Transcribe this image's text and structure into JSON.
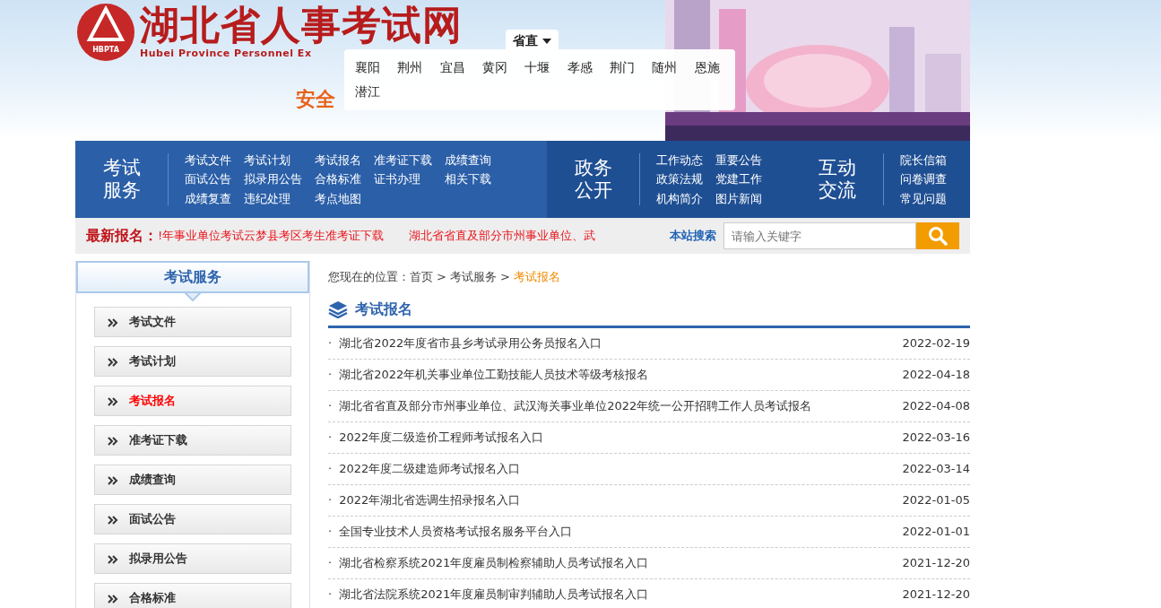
{
  "header": {
    "logo_abbr": "HBPTA",
    "site_title": "湖北省人事考试网",
    "site_subtitle": "Hubei Province Personnel Ex",
    "slogan": "安全",
    "region_menu": {
      "label": "省直",
      "expanded": true,
      "cities": [
        "襄阳",
        "荆州",
        "宜昌",
        "黄冈",
        "十堰",
        "孝感",
        "荆门",
        "随州",
        "恩施",
        "潜江"
      ]
    }
  },
  "nav": [
    {
      "title": "考试服务",
      "links": [
        "考试文件",
        "考试计划",
        "考试报名",
        "准考证下载",
        "成绩查询",
        "面试公告",
        "拟录用公告",
        "合格标准",
        "证书办理",
        "相关下载",
        "成绩复查",
        "违纪处理",
        "考点地图"
      ]
    },
    {
      "title": "政务公开",
      "links": [
        "工作动态",
        "重要公告",
        "政策法规",
        "党建工作",
        "机构简介",
        "图片新闻"
      ]
    },
    {
      "title": "互动交流",
      "links": [
        "院长信箱",
        "问卷调查",
        "常见问题"
      ]
    }
  ],
  "ticker": {
    "label": "最新报名：",
    "items": [
      "!年事业单位考试云梦县考区考生准考证下载",
      "湖北省省直及部分市州事业单位、武"
    ]
  },
  "search": {
    "label": "本站搜索",
    "placeholder": "请输入关键字"
  },
  "sidebar": {
    "title": "考试服务",
    "items": [
      {
        "label": "考试文件",
        "selected": false
      },
      {
        "label": "考试计划",
        "selected": false
      },
      {
        "label": "考试报名",
        "selected": true
      },
      {
        "label": "准考证下载",
        "selected": false
      },
      {
        "label": "成绩查询",
        "selected": false
      },
      {
        "label": "面试公告",
        "selected": false
      },
      {
        "label": "拟录用公告",
        "selected": false
      },
      {
        "label": "合格标准",
        "selected": false
      }
    ]
  },
  "breadcrumb": {
    "prefix": "您现在的位置：",
    "separator": ">",
    "items": [
      {
        "label": "首页",
        "selected": false
      },
      {
        "label": "考试服务",
        "selected": false
      },
      {
        "label": "考试报名",
        "selected": true
      }
    ]
  },
  "section_title": "考试报名",
  "article_bullet": "·",
  "articles": [
    {
      "title": "湖北省2022年度省市县乡考试录用公务员报名入口",
      "date": "2022-02-19"
    },
    {
      "title": "湖北省2022年机关事业单位工勤技能人员技术等级考核报名",
      "date": "2022-04-18"
    },
    {
      "title": "湖北省省直及部分市州事业单位、武汉海关事业单位2022年统一公开招聘工作人员考试报名",
      "date": "2022-04-08"
    },
    {
      "title": "2022年度二级造价工程师考试报名入口",
      "date": "2022-03-16"
    },
    {
      "title": "2022年度二级建造师考试报名入口",
      "date": "2022-03-14"
    },
    {
      "title": "2022年湖北省选调生招录报名入口",
      "date": "2022-01-05"
    },
    {
      "title": "全国专业技术人员资格考试报名服务平台入口",
      "date": "2022-01-01"
    },
    {
      "title": "湖北省检察系统2021年度雇员制检察辅助人员考试报名入口",
      "date": "2021-12-20"
    },
    {
      "title": "湖北省法院系统2021年度雇员制审判辅助人员考试报名入口",
      "date": "2021-12-20"
    }
  ]
}
